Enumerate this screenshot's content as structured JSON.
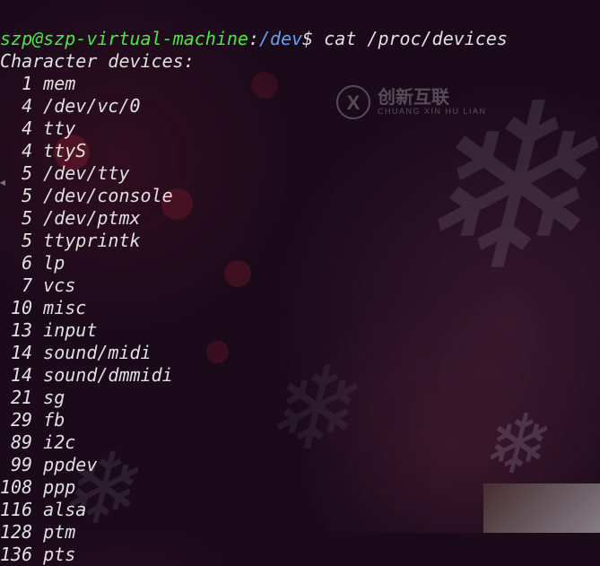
{
  "prompt": {
    "user": "szp@szp-virtual-machine",
    "colon": ":",
    "path": "/dev",
    "dollar": "$",
    "command": "cat /proc/devices"
  },
  "header": "Character devices:",
  "devices": [
    {
      "num": "1",
      "name": "mem"
    },
    {
      "num": "4",
      "name": "/dev/vc/0"
    },
    {
      "num": "4",
      "name": "tty"
    },
    {
      "num": "4",
      "name": "ttyS"
    },
    {
      "num": "5",
      "name": "/dev/tty"
    },
    {
      "num": "5",
      "name": "/dev/console"
    },
    {
      "num": "5",
      "name": "/dev/ptmx"
    },
    {
      "num": "5",
      "name": "ttyprintk"
    },
    {
      "num": "6",
      "name": "lp"
    },
    {
      "num": "7",
      "name": "vcs"
    },
    {
      "num": "10",
      "name": "misc"
    },
    {
      "num": "13",
      "name": "input"
    },
    {
      "num": "14",
      "name": "sound/midi"
    },
    {
      "num": "14",
      "name": "sound/dmmidi"
    },
    {
      "num": "21",
      "name": "sg"
    },
    {
      "num": "29",
      "name": "fb"
    },
    {
      "num": "89",
      "name": "i2c"
    },
    {
      "num": "99",
      "name": "ppdev"
    },
    {
      "num": "108",
      "name": "ppp"
    },
    {
      "num": "116",
      "name": "alsa"
    },
    {
      "num": "128",
      "name": "ptm"
    },
    {
      "num": "136",
      "name": "pts"
    }
  ],
  "watermark": {
    "icon": "X",
    "cn": "创新互联",
    "py": "CHUANG XIN HU LIAN"
  },
  "left_arrow": "◂"
}
